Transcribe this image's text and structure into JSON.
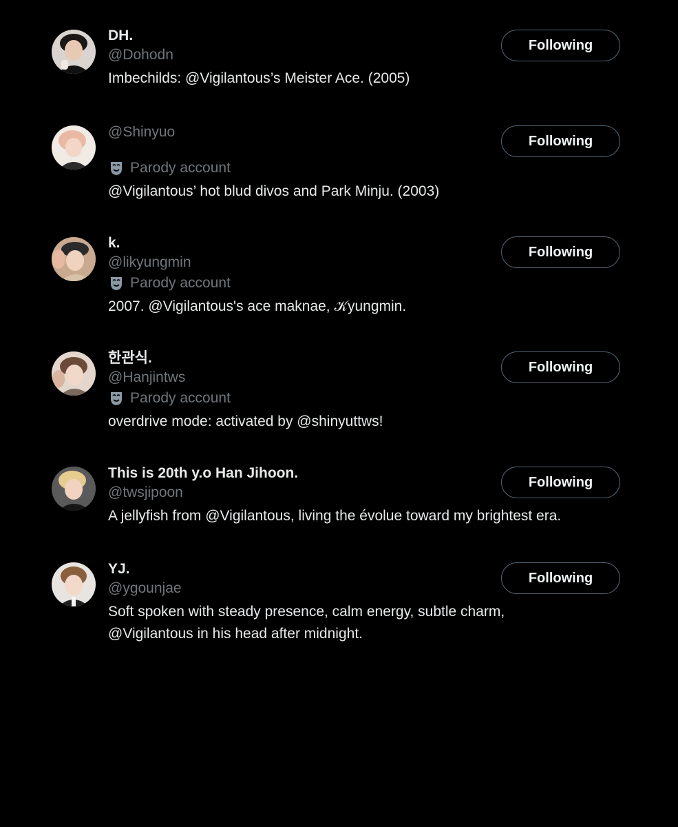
{
  "accounts": [
    {
      "name": "DH.",
      "handle": "@Dohodn",
      "parody_label": "",
      "bio": "Imbechilds: @Vigilantous’s Meister Ace. (2005)",
      "button_label": "Following"
    },
    {
      "name": "",
      "handle": "@Shinyuo",
      "parody_label": "Parody account",
      "bio": "@Vigilantous’ hot blud divos and Park Minju. (2003)",
      "button_label": "Following"
    },
    {
      "name": "k.",
      "handle": "@likyungmin",
      "parody_label": "Parody account",
      "bio": "2007. @Vigilantous's ace maknae, 𝒦yungmin.",
      "button_label": "Following"
    },
    {
      "name": "한관식.",
      "handle": "@Hanjintws",
      "parody_label": "Parody account",
      "bio": "overdrive mode: activated by @shinyuttws!",
      "button_label": "Following"
    },
    {
      "name": "This is 20th y.o Han Jihoon.",
      "handle": "@twsjipoon",
      "parody_label": "",
      "bio": "A jellyfish from @Vigilantous, living the évolue toward my brightest era.",
      "button_label": "Following"
    },
    {
      "name": "YJ.",
      "handle": "@ygounjae",
      "parody_label": "",
      "bio": "Soft spoken with steady presence, calm energy, subtle charm, @Vigilantous in his head after midnight.",
      "button_label": "Following"
    }
  ],
  "icons": {
    "parody": "theater-mask-icon"
  },
  "colors": {
    "background": "#000000",
    "primary_text": "#e7e9ea",
    "secondary_text": "#71767b",
    "button_border": "#536471"
  }
}
